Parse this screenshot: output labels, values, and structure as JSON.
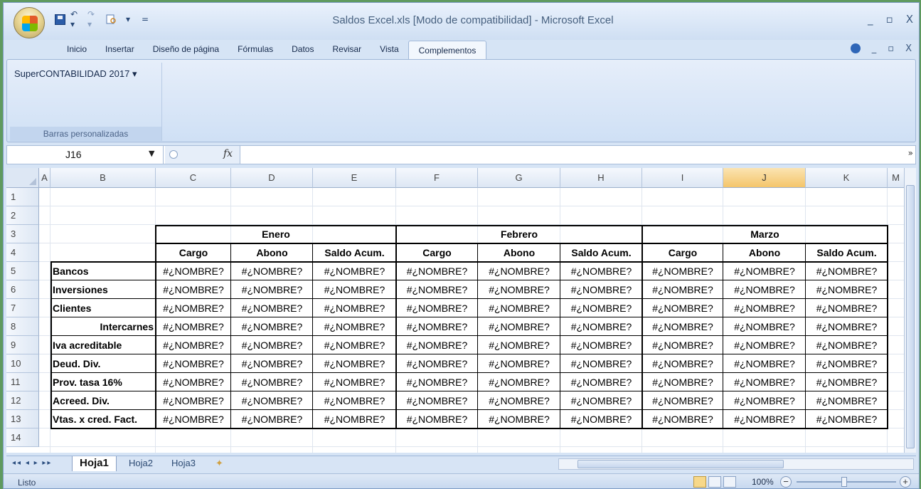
{
  "window": {
    "title": "Saldos Excel.xls  [Modo de compatibilidad] - Microsoft Excel",
    "controls": [
      "_",
      "▫",
      "X"
    ],
    "ribbon_controls": [
      "_",
      "▫",
      "X"
    ]
  },
  "quick_access": {
    "undo": "↶ ▾",
    "redo": "↷ ▾",
    "print": "▾",
    "customize": "="
  },
  "tabs": [
    "Inicio",
    "Insertar",
    "Diseño de página",
    "Fórmulas",
    "Datos",
    "Revisar",
    "Vista",
    "Complementos"
  ],
  "active_tab": "Complementos",
  "ribbon": {
    "addin_button": "SuperCONTABILIDAD 2017 ▾",
    "group_label": "Barras personalizadas"
  },
  "formula_bar": {
    "name_box": "J16",
    "fx": "fx",
    "formula": ""
  },
  "columns": [
    "A",
    "B",
    "C",
    "D",
    "E",
    "F",
    "G",
    "H",
    "I",
    "J",
    "K",
    "M"
  ],
  "selected_column": "J",
  "rows": [
    "1",
    "2",
    "3",
    "4",
    "5",
    "6",
    "7",
    "8",
    "9",
    "10",
    "11",
    "12",
    "13",
    "14"
  ],
  "table": {
    "months": [
      "Enero",
      "Febrero",
      "Marzo"
    ],
    "subheaders": [
      "Cargo",
      "Abono",
      "Saldo Acum.",
      "Cargo",
      "Abono",
      "Saldo Acum.",
      "Cargo",
      "Abono",
      "Saldo Acum."
    ],
    "row_labels": [
      "Bancos",
      "Inversiones",
      "Clientes",
      "Intercarnes",
      "Iva acreditable",
      "Deud. Div.",
      "Prov. tasa 16%",
      "Acreed. Div.",
      "Vtas. x cred. Fact."
    ],
    "error_value": "#¿NOMBRE?"
  },
  "sheet_tabs": [
    "Hoja1",
    "Hoja2",
    "Hoja3"
  ],
  "active_sheet": "Hoja1",
  "status": {
    "ready": "Listo",
    "zoom": "100%",
    "zoom_minus": "−",
    "zoom_plus": "+"
  },
  "colors": {
    "accent": "#f4c56a",
    "window_bg": "#d6e4f5",
    "desktop": "#5f9a5f"
  }
}
